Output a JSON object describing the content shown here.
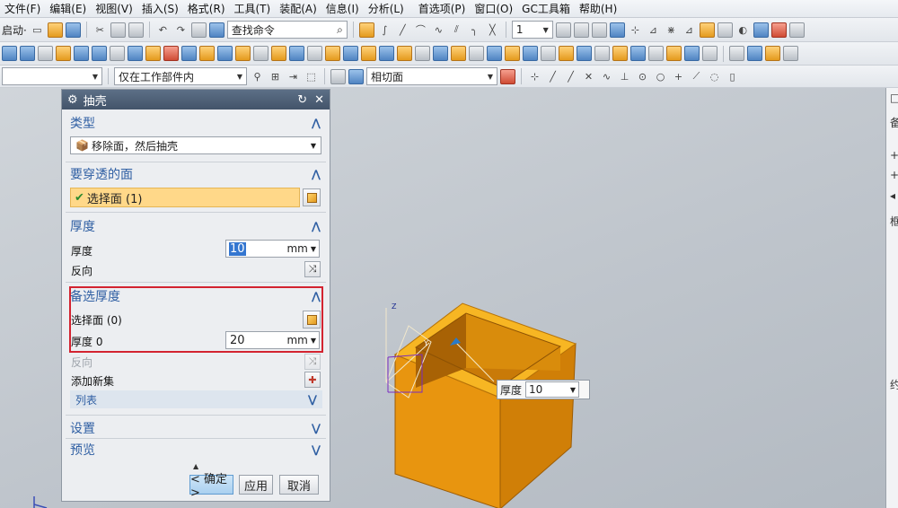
{
  "menubar": {
    "items": [
      "文件(F)",
      "编辑(E)",
      "视图(V)",
      "插入(S)",
      "格式(R)",
      "工具(T)",
      "装配(A)",
      "信息(I)",
      "分析(L)",
      "首选项(P)",
      "窗口(O)",
      "GC工具箱",
      "帮助(H)"
    ]
  },
  "toolbar1": {
    "start_label": "启动·",
    "search_placeholder": "查找命令",
    "layer_value": "1"
  },
  "toolbar3": {
    "filter_value": "",
    "scope_value": "仅在工作部件内",
    "snap_value": "相切面"
  },
  "dialog": {
    "title": "抽壳",
    "sections": {
      "type": {
        "title": "类型",
        "value": "移除面，然后抽壳"
      },
      "faces": {
        "title": "要穿透的面",
        "select_label": "选择面 (1)"
      },
      "thickness": {
        "title": "厚度",
        "thickness_label": "厚度",
        "thickness_value": "10",
        "unit": "mm",
        "reverse_label": "反向"
      },
      "alt": {
        "title": "备选厚度",
        "select_label": "选择面 (0)",
        "thickness_label": "厚度 0",
        "thickness_value": "20",
        "unit": "mm",
        "reverse_label": "反向",
        "add_set_label": "添加新集",
        "list_label": "列表"
      },
      "settings": {
        "title": "设置"
      },
      "preview": {
        "title": "预览"
      }
    },
    "buttons": {
      "ok": "< 确定 >",
      "apply": "应用",
      "cancel": "取消"
    }
  },
  "viewport": {
    "thickness_tag": {
      "label": "厚度",
      "value": "10"
    }
  },
  "right_panel": {
    "items": [
      "备",
      "+",
      "+",
      "◂",
      "框",
      "约"
    ]
  },
  "colors": {
    "accent": "#2f5fa3",
    "selection": "#ffd889",
    "highlight_box": "#d32330",
    "model": "#e8950f"
  }
}
